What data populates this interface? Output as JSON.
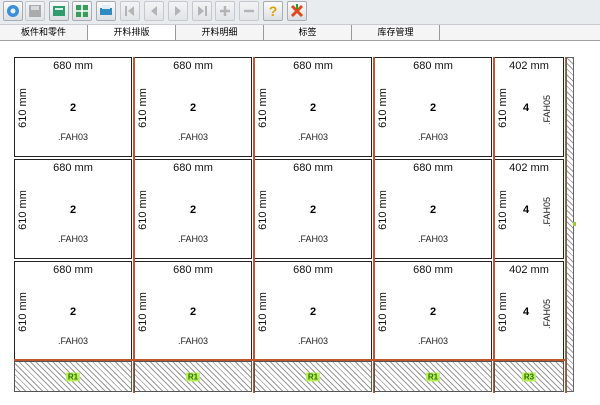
{
  "toolbar": {
    "buttons": [
      {
        "name": "open-icon",
        "enabled": true
      },
      {
        "name": "save-icon",
        "enabled": false
      },
      {
        "name": "edit-icon",
        "enabled": true
      },
      {
        "name": "layout-icon",
        "enabled": true
      },
      {
        "name": "print-icon",
        "enabled": true
      },
      {
        "name": "first-page-icon",
        "enabled": false
      },
      {
        "name": "prev-page-icon",
        "enabled": false
      },
      {
        "name": "next-page-icon",
        "enabled": false
      },
      {
        "name": "last-page-icon",
        "enabled": false
      },
      {
        "name": "zoom-in-icon",
        "enabled": false
      },
      {
        "name": "zoom-out-icon",
        "enabled": false
      },
      {
        "name": "help-icon",
        "enabled": true
      },
      {
        "name": "exit-icon",
        "enabled": true
      }
    ]
  },
  "tabs": [
    {
      "label": "板件和零件",
      "active": false
    },
    {
      "label": "开料排版",
      "active": true
    },
    {
      "label": "开料明细",
      "active": false
    },
    {
      "label": "标签",
      "active": false
    },
    {
      "label": "库存管理",
      "active": false
    }
  ],
  "panels": [
    {
      "width": "680 mm",
      "height": "610 mm",
      "qty": "2",
      "code": ".FAH03",
      "narrow": false
    },
    {
      "width": "680 mm",
      "height": "610 mm",
      "qty": "2",
      "code": ".FAH03",
      "narrow": false
    },
    {
      "width": "680 mm",
      "height": "610 mm",
      "qty": "2",
      "code": ".FAH03",
      "narrow": false
    },
    {
      "width": "680 mm",
      "height": "610 mm",
      "qty": "2",
      "code": ".FAH03",
      "narrow": false
    },
    {
      "width": "402 mm",
      "height": "610 mm",
      "qty": "4",
      "code": ".FAH05",
      "narrow": true
    },
    {
      "width": "680 mm",
      "height": "610 mm",
      "qty": "2",
      "code": ".FAH03",
      "narrow": false
    },
    {
      "width": "680 mm",
      "height": "610 mm",
      "qty": "2",
      "code": ".FAH03",
      "narrow": false
    },
    {
      "width": "680 mm",
      "height": "610 mm",
      "qty": "2",
      "code": ".FAH03",
      "narrow": false
    },
    {
      "width": "680 mm",
      "height": "610 mm",
      "qty": "2",
      "code": ".FAH03",
      "narrow": false
    },
    {
      "width": "402 mm",
      "height": "610 mm",
      "qty": "4",
      "code": ".FAH05",
      "narrow": true
    },
    {
      "width": "680 mm",
      "height": "610 mm",
      "qty": "2",
      "code": ".FAH03",
      "narrow": false
    },
    {
      "width": "680 mm",
      "height": "610 mm",
      "qty": "2",
      "code": ".FAH03",
      "narrow": false
    },
    {
      "width": "680 mm",
      "height": "610 mm",
      "qty": "2",
      "code": ".FAH03",
      "narrow": false
    },
    {
      "width": "680 mm",
      "height": "610 mm",
      "qty": "2",
      "code": ".FAH03",
      "narrow": false
    },
    {
      "width": "402 mm",
      "height": "610 mm",
      "qty": "4",
      "code": ".FAH05",
      "narrow": true
    }
  ],
  "offcuts": [
    {
      "label": "R1"
    },
    {
      "label": "R1"
    },
    {
      "label": "R1"
    },
    {
      "label": "R1"
    },
    {
      "label": "R3"
    }
  ],
  "colors": {
    "cut_line": "#c0562b",
    "offcut_label_bg": "#b8f060"
  }
}
